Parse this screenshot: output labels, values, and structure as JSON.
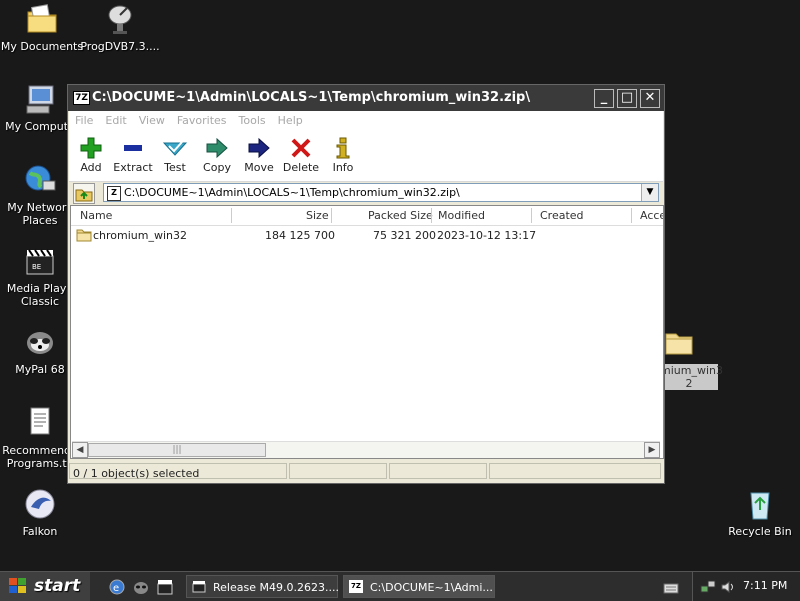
{
  "desktop_icons": [
    {
      "name": "desktop-icon-my-documents",
      "label": "My Documents"
    },
    {
      "name": "desktop-icon-progdvb",
      "label": "ProgDVB7.3...."
    },
    {
      "name": "desktop-icon-my-computer",
      "label": "My Compute"
    },
    {
      "name": "desktop-icon-my-network-places",
      "label_line1": "My Network",
      "label_line2": "Places"
    },
    {
      "name": "desktop-icon-media-player-classic",
      "label_line1": "Media Playe",
      "label_line2": "Classic"
    },
    {
      "name": "desktop-icon-mypal",
      "label": "MyPal 68"
    },
    {
      "name": "desktop-icon-recommended-programs",
      "label_line1": "Recommende",
      "label_line2": "Programs.tx"
    },
    {
      "name": "desktop-icon-falkon",
      "label": "Falkon"
    },
    {
      "name": "desktop-icon-chromium-win32",
      "label_line1": "mium_win3",
      "label_line2": "2"
    },
    {
      "name": "desktop-icon-recycle-bin",
      "label": "Recycle Bin"
    }
  ],
  "window": {
    "app_icon": "7Z",
    "title": "C:\\DOCUME~1\\Admin\\LOCALS~1\\Temp\\chromium_win32.zip\\",
    "menu": [
      "File",
      "Edit",
      "View",
      "Favorites",
      "Tools",
      "Help"
    ],
    "toolbar": [
      {
        "label": "Add",
        "icon": "plus-icon",
        "color": "#22a022"
      },
      {
        "label": "Extract",
        "icon": "minus-icon",
        "color": "#1c2fa0"
      },
      {
        "label": "Test",
        "icon": "check-icon",
        "color": "#3aa6c8"
      },
      {
        "label": "Copy",
        "icon": "arrow-right-icon",
        "color": "#2e8c6a"
      },
      {
        "label": "Move",
        "icon": "arrow-right-icon",
        "color": "#1c2580"
      },
      {
        "label": "Delete",
        "icon": "x-icon",
        "color": "#d01818"
      },
      {
        "label": "Info",
        "icon": "info-icon",
        "color": "#d0b020"
      }
    ],
    "address": {
      "icon": "Z",
      "path": "C:\\DOCUME~1\\Admin\\LOCALS~1\\Temp\\chromium_win32.zip\\"
    },
    "columns": [
      "Name",
      "Size",
      "Packed Size",
      "Modified",
      "Created",
      "Acce"
    ],
    "rows": [
      {
        "name": "chromium_win32",
        "size": "184 125 700",
        "packed": "75 321 200",
        "modified": "2023-10-12 13:17",
        "created": ""
      }
    ],
    "status": "0 / 1 object(s) selected"
  },
  "taskbar": {
    "start_label": "start",
    "tasks": [
      {
        "label": "Release M49.0.2623....",
        "icon": "media-icon"
      },
      {
        "label": "C:\\DOCUME~1\\Admi...",
        "icon": "7z-icon",
        "app_icon": "7Z"
      }
    ],
    "clock": "7:11 PM"
  }
}
